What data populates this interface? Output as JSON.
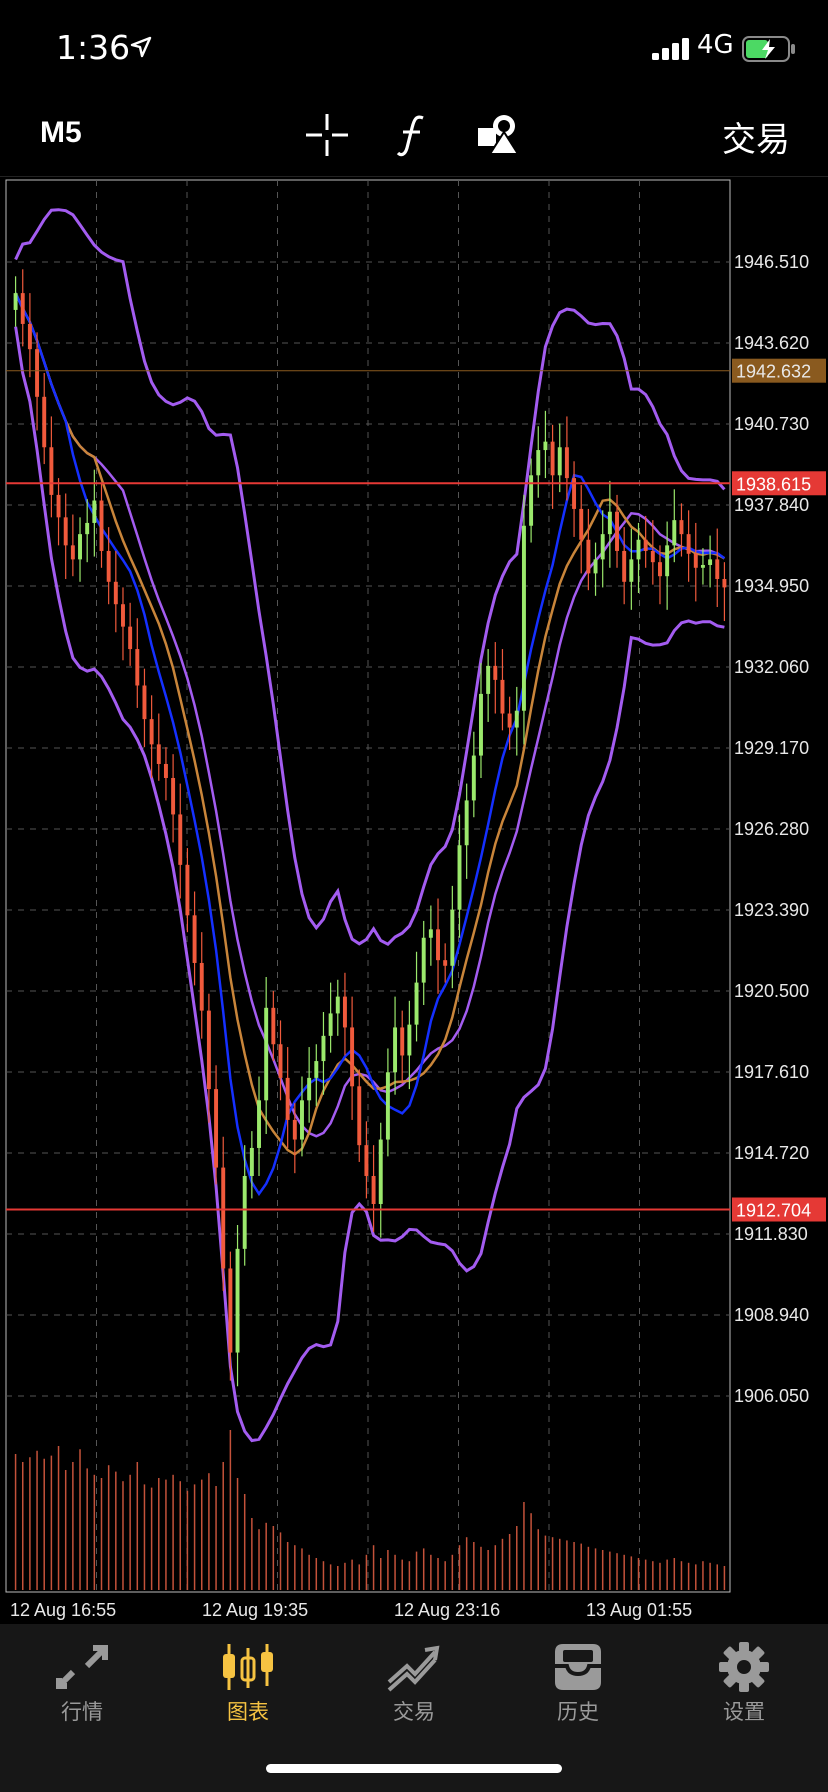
{
  "status_bar": {
    "time": "1:36",
    "network": "4G"
  },
  "toolbar": {
    "timeframe": "M5",
    "trade_label": "交易"
  },
  "chart_data": {
    "type": "candlestick",
    "price_labels": [
      "1946.510",
      "1943.620",
      "1940.730",
      "1937.840",
      "1934.950",
      "1932.060",
      "1929.170",
      "1926.280",
      "1923.390",
      "1920.500",
      "1917.610",
      "1914.720",
      "1911.830",
      "1908.940",
      "1906.050"
    ],
    "markers": [
      {
        "label": "1942.632",
        "price": 1942.632,
        "color": "#8a5a1f"
      },
      {
        "label": "1938.615",
        "price": 1938.615,
        "color": "#e53935"
      },
      {
        "label": "1912.704",
        "price": 1912.704,
        "color": "#e53935"
      }
    ],
    "time_labels": [
      "12 Aug 16:55",
      "12 Aug 19:35",
      "12 Aug 23:16",
      "13 Aug 01:55"
    ],
    "closes": [
      1945.4,
      1944.3,
      1943.4,
      1941.7,
      1939.9,
      1938.2,
      1937.4,
      1936.4,
      1935.9,
      1936.8,
      1937.2,
      1938.0,
      1936.2,
      1935.1,
      1934.3,
      1933.5,
      1932.7,
      1931.4,
      1930.2,
      1929.3,
      1928.6,
      1928.1,
      1926.8,
      1925.0,
      1923.2,
      1921.5,
      1919.8,
      1917.0,
      1914.2,
      1910.6,
      1907.6,
      1911.3,
      1913.9,
      1914.9,
      1916.6,
      1919.9,
      1918.6,
      1917.4,
      1915.9,
      1915.2,
      1916.6,
      1917.4,
      1918.0,
      1918.9,
      1919.7,
      1920.3,
      1919.2,
      1917.1,
      1915.0,
      1913.9,
      1912.9,
      1915.2,
      1917.6,
      1919.2,
      1918.2,
      1919.3,
      1920.8,
      1922.4,
      1922.7,
      1921.6,
      1921.4,
      1923.4,
      1925.7,
      1927.3,
      1928.9,
      1931.1,
      1932.1,
      1931.6,
      1930.4,
      1929.9,
      1930.5,
      1937.1,
      1938.9,
      1939.8,
      1940.1,
      1938.9,
      1939.9,
      1938.8,
      1937.7,
      1936.6,
      1935.4,
      1935.9,
      1936.8,
      1937.6,
      1936.2,
      1935.1,
      1935.9,
      1936.6,
      1936.2,
      1935.8,
      1935.3,
      1936.4,
      1937.3,
      1936.8,
      1936.1,
      1935.6,
      1935.7,
      1935.9,
      1935.2,
      1934.9
    ],
    "volumes": [
      85,
      80,
      83,
      87,
      82,
      84,
      90,
      75,
      80,
      88,
      76,
      72,
      70,
      78,
      74,
      68,
      72,
      80,
      66,
      64,
      70,
      69,
      72,
      68,
      62,
      66,
      69,
      73,
      65,
      80,
      100,
      70,
      60,
      45,
      38,
      42,
      40,
      36,
      30,
      28,
      26,
      22,
      20,
      18,
      16,
      15,
      17,
      19,
      16,
      22,
      28,
      20,
      25,
      22,
      19,
      18,
      24,
      26,
      22,
      20,
      18,
      22,
      28,
      33,
      30,
      27,
      25,
      28,
      32,
      35,
      40,
      55,
      48,
      38,
      34,
      33,
      32,
      31,
      30,
      29,
      27,
      26,
      25,
      24,
      23,
      22,
      21,
      20,
      19,
      18,
      17,
      19,
      20,
      18,
      17,
      16,
      18,
      17,
      16,
      15
    ]
  },
  "tabs": [
    {
      "label": "行情",
      "icon": "quotes-icon"
    },
    {
      "label": "图表",
      "icon": "chart-icon"
    },
    {
      "label": "交易",
      "icon": "trade-icon"
    },
    {
      "label": "历史",
      "icon": "history-icon"
    },
    {
      "label": "设置",
      "icon": "settings-icon"
    }
  ],
  "colors": {
    "bull": "#9be86c",
    "bear": "#f05a3c",
    "band": "#a35cf0",
    "ma_fast": "#1530ff",
    "ma_slow": "#c9853a",
    "active_tab": "#f6c342"
  }
}
